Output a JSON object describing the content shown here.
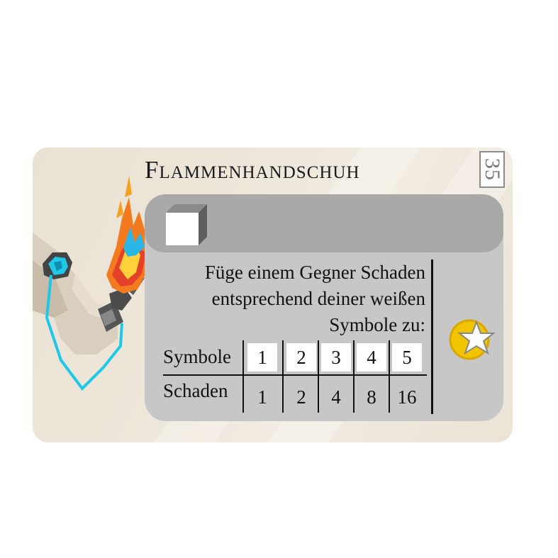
{
  "card": {
    "title": "Flammenhandschuh",
    "number": "35",
    "cost_icon": "white-cube-icon",
    "description": [
      "Füge einem Gegner Schaden",
      "entsprechend deiner weißen",
      "Symbole zu:"
    ],
    "reward_icon": "star-icon",
    "table": {
      "row1_label": "Symbole",
      "row2_label": "Schaden",
      "symbols": [
        "1",
        "2",
        "3",
        "4",
        "5"
      ],
      "damage": [
        "1",
        "2",
        "4",
        "8",
        "16"
      ]
    },
    "illustration_icon": "flame-gauntlet-icon"
  },
  "colors": {
    "card_bg": "#ece5d8",
    "panel": "#c7c7c7",
    "panel_header": "#a9a9a9",
    "star_gold": "#f2c400",
    "flame_orange": "#f47a20",
    "gauntlet_cyan": "#1ec8e8"
  }
}
